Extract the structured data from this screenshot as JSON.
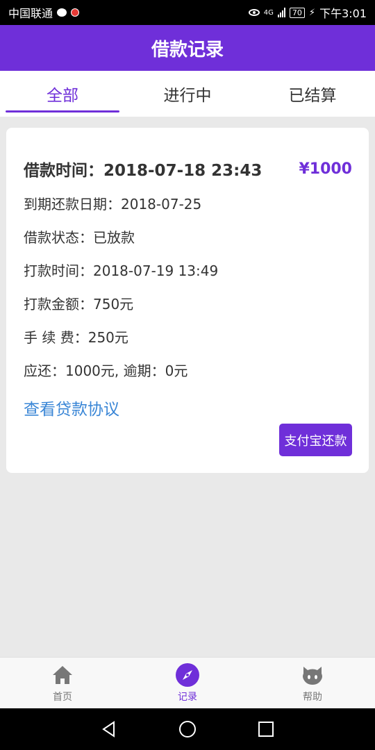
{
  "status_bar": {
    "carrier": "中国联通",
    "network": "4G",
    "battery": "70",
    "time": "下午3:01"
  },
  "header": {
    "title": "借款记录"
  },
  "tabs": [
    {
      "label": "全部",
      "active": true
    },
    {
      "label": "进行中",
      "active": false
    },
    {
      "label": "已结算",
      "active": false
    }
  ],
  "loan_card": {
    "title": "借款时间：2018-07-18 23:43",
    "amount": "¥1000",
    "due_date": "到期还款日期：2018-07-25",
    "status": "借款状态：已放款",
    "payout_time": "打款时间：2018-07-19 13:49",
    "payout_amount": "打款金额：750元",
    "fee": "手 续 费：250元",
    "repay": "应还：1000元, 逾期：0元",
    "agreement_link": "查看贷款协议",
    "pay_button": "支付宝还款"
  },
  "bottom_nav": [
    {
      "label": "首页",
      "icon": "home-icon",
      "active": false
    },
    {
      "label": "记录",
      "icon": "compass-icon",
      "active": true
    },
    {
      "label": "帮助",
      "icon": "github-cat-icon",
      "active": false
    }
  ],
  "colors": {
    "primary": "#6f2fd9",
    "link": "#3a86d6",
    "background": "#e9e9e9"
  }
}
